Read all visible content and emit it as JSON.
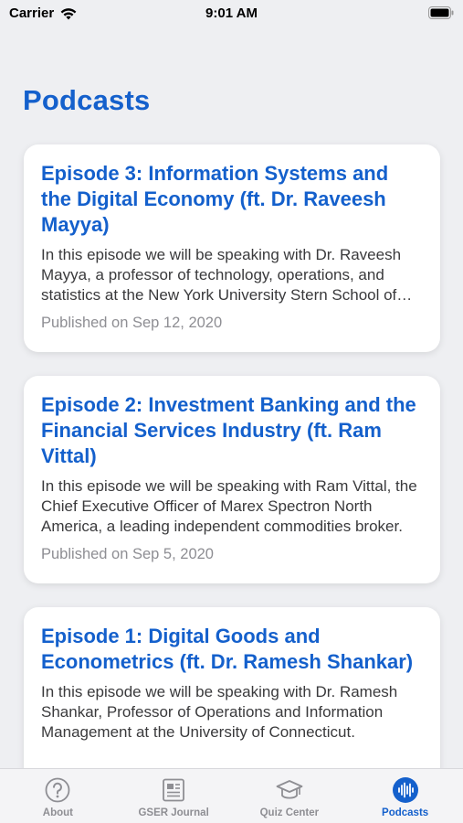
{
  "status_bar": {
    "carrier": "Carrier",
    "time": "9:01 AM",
    "icons": [
      "wifi-icon",
      "battery-icon"
    ]
  },
  "page": {
    "title": "Podcasts"
  },
  "episodes": [
    {
      "title": "Episode 3: Information Systems and the Digital Economy (ft. Dr. Raveesh Mayya)",
      "description": "In this episode we will be speaking with Dr. Raveesh Mayya, a professor of technology, operations, and statistics at the New York University Stern School of Business.",
      "date": "Published on Sep 12, 2020"
    },
    {
      "title": "Episode 2: Investment Banking and the Financial Services Industry (ft. Ram Vittal)",
      "description": "In this episode we will be speaking with Ram Vittal, the Chief Executive Officer of Marex Spectron North America, a leading independent commodities broker.",
      "date": "Published on Sep 5, 2020"
    },
    {
      "title": "Episode 1: Digital Goods and Econometrics (ft. Dr. Ramesh Shankar)",
      "description": "In this episode we will be speaking with Dr. Ramesh Shankar, Professor of Operations and Information Management at the University of Connecticut.",
      "date": ""
    }
  ],
  "tab_bar": {
    "tabs": [
      {
        "label": "About",
        "icon": "question-circle-icon",
        "active": false
      },
      {
        "label": "GSER Journal",
        "icon": "newspaper-icon",
        "active": false
      },
      {
        "label": "Quiz Center",
        "icon": "graduation-cap-icon",
        "active": false
      },
      {
        "label": "Podcasts",
        "icon": "waveform-icon",
        "active": true
      }
    ]
  },
  "colors": {
    "accent": "#1460cc",
    "background": "#eeeff2",
    "inactive": "#8e8e93"
  }
}
